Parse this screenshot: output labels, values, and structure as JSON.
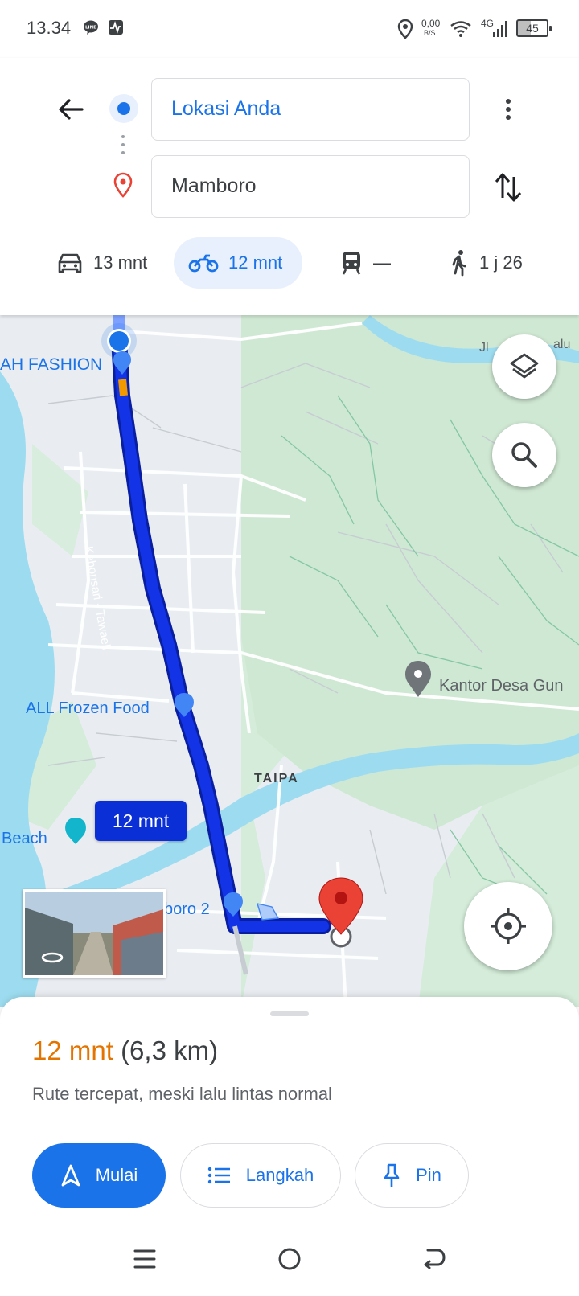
{
  "status_bar": {
    "time": "13.34",
    "net_speed_value": "0,00",
    "net_speed_unit": "B/S",
    "network_type": "4G",
    "battery": "45",
    "icons": [
      "line-app-icon",
      "activity-icon",
      "location-icon",
      "wifi-icon",
      "signal-icon",
      "battery-icon"
    ]
  },
  "directions": {
    "origin": "Lokasi Anda",
    "destination": "Mamboro"
  },
  "modes": [
    {
      "icon": "car-icon",
      "label": "13 mnt",
      "active": false
    },
    {
      "icon": "motorcycle-icon",
      "label": "12 mnt",
      "active": true
    },
    {
      "icon": "train-icon",
      "label": "—",
      "active": false
    },
    {
      "icon": "walk-icon",
      "label": "1 j 26",
      "active": false
    }
  ],
  "map": {
    "labels": {
      "fashion": "AH FASHION",
      "road_partial": "Jl",
      "road_partial_right": "alu",
      "road_name": "Kebonsari - Tawaeli",
      "frozen_food": "ALL Frozen Food",
      "kantor": "Kantor Desa Gun",
      "taipa": "TAIPA",
      "beach": "Beach",
      "mart_partial": "boro 2"
    },
    "route_duration_chip": "12 mnt"
  },
  "sheet": {
    "duration": "12 mnt",
    "distance": "(6,3 km)",
    "description": "Rute tercepat, meski lalu lintas normal",
    "buttons": {
      "start": "Mulai",
      "steps": "Langkah",
      "pin": "Pin"
    }
  },
  "colors": {
    "accent": "#1a73e8",
    "route": "#1233e6",
    "duration": "#e37400",
    "destination_pin": "#ea4335"
  }
}
